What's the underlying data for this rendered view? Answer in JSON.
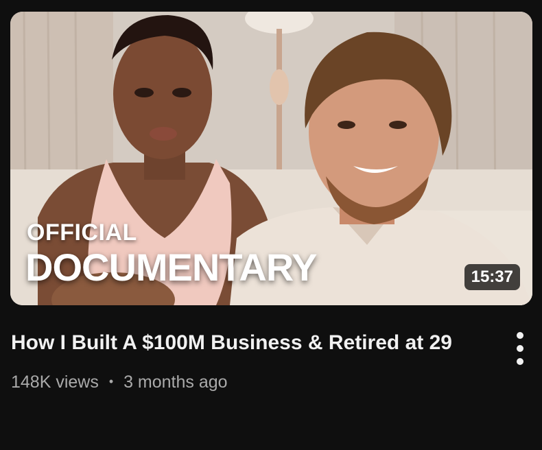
{
  "video": {
    "thumbnail_overlay_line1": "OFFICIAL",
    "thumbnail_overlay_line2": "DOCUMENTARY",
    "duration": "15:37",
    "title": "How I Built A $100M Business & Retired at 29",
    "views": "148K views",
    "separator": "•",
    "age": "3 months ago"
  },
  "icons": {
    "menu": "more-vert-icon"
  },
  "colors": {
    "background": "#0f0f0f",
    "title_text": "#f1f1f1",
    "secondary_text": "#aaaaaa",
    "duration_badge_bg": "#000000"
  }
}
